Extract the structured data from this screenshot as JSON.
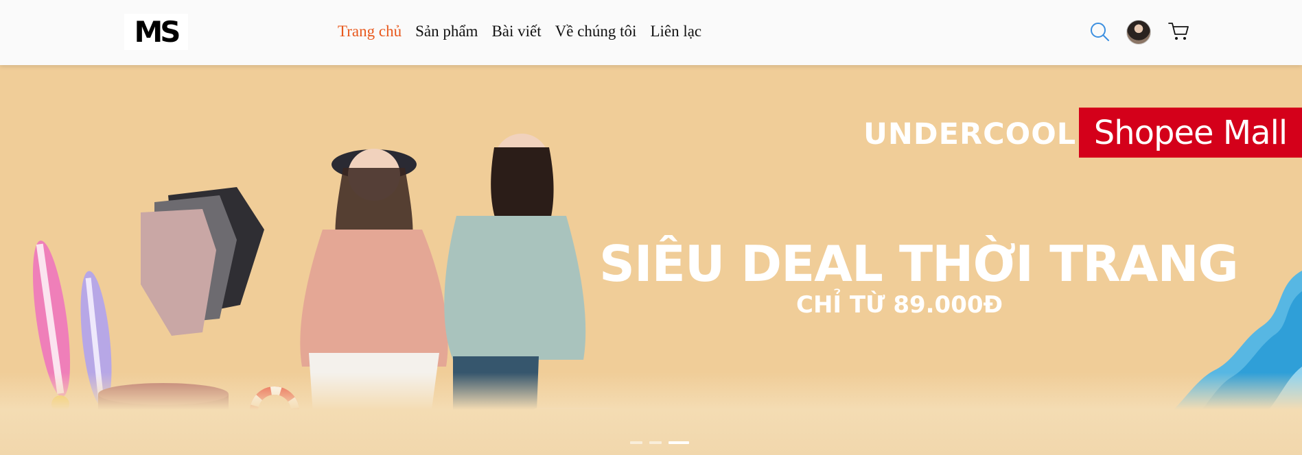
{
  "header": {
    "logo_text": "MS",
    "nav": [
      {
        "label": "Trang chủ",
        "active": true
      },
      {
        "label": "Sản phẩm",
        "active": false
      },
      {
        "label": "Bài viết",
        "active": false
      },
      {
        "label": "Về chúng tôi",
        "active": false
      },
      {
        "label": "Liên lạc",
        "active": false
      }
    ],
    "icons": [
      "search-icon",
      "avatar",
      "cart-icon"
    ],
    "colors": {
      "accent_nav": "#e8581c",
      "search_icon": "#3b8fe0",
      "header_bg": "#fafafa"
    }
  },
  "banner": {
    "brand": "UNDERCOOL",
    "badge": "Shopee Mall",
    "headline": "SIÊU DEAL THỜI TRANG",
    "subline": "CHỈ TỪ 89.000Đ",
    "slide_count": 3,
    "active_slide": 3,
    "colors": {
      "background": "#f0cd98",
      "badge_bg": "#d4001a"
    }
  }
}
